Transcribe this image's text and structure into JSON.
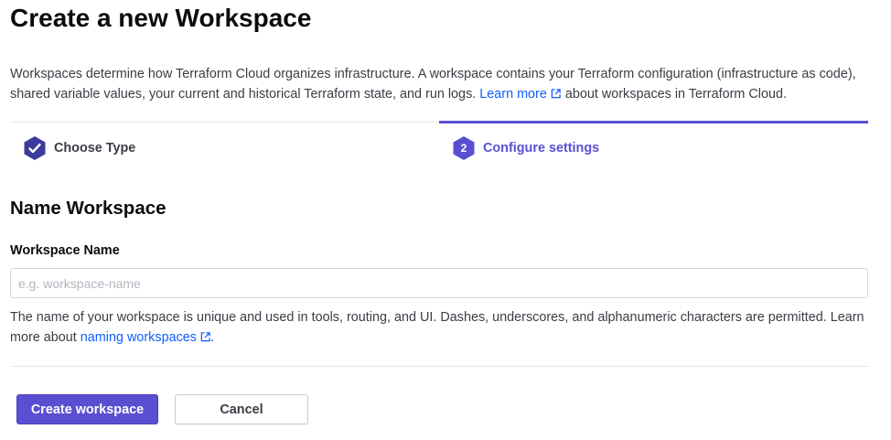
{
  "page": {
    "title": "Create a new Workspace"
  },
  "intro": {
    "text_before": "Workspaces determine how Terraform Cloud organizes infrastructure. A workspace contains your Terraform configuration (infrastructure as code), shared variable values, your current and historical Terraform state, and run logs.",
    "link_label": "Learn more",
    "link_icon": "external-link-icon",
    "text_after": "about workspaces in Terraform Cloud."
  },
  "steps": [
    {
      "label": "Choose Type",
      "status": "complete",
      "icon": "check-icon",
      "color": "#3d3a9e"
    },
    {
      "label": "Configure settings",
      "number": "2",
      "status": "active",
      "color": "#5b4fd1"
    }
  ],
  "form": {
    "section_title": "Name Workspace",
    "name_field": {
      "label": "Workspace Name",
      "value": "",
      "placeholder": "e.g. workspace-name"
    },
    "help": {
      "text_before": "The name of your workspace is unique and used in tools, routing, and UI. Dashes, underscores, and alphanumeric characters are permitted. Learn more about",
      "link_label": "naming workspaces",
      "link_icon": "external-link-icon",
      "text_after": "."
    }
  },
  "actions": {
    "create_label": "Create workspace",
    "cancel_label": "Cancel"
  },
  "colors": {
    "accent": "#5b4fd1",
    "link": "#1060ff",
    "text": "#3b3d45"
  }
}
